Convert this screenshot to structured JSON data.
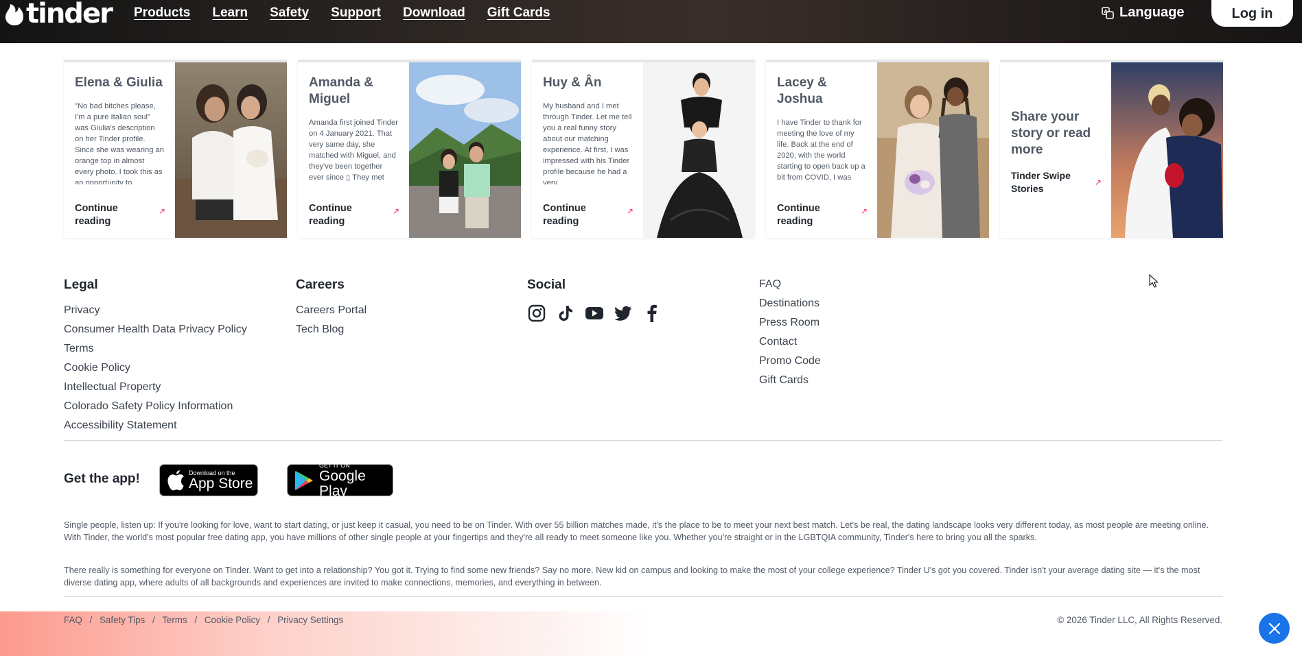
{
  "nav": {
    "logo_text": "tinder",
    "links": [
      "Products",
      "Learn",
      "Safety",
      "Support",
      "Download",
      "Gift Cards"
    ],
    "language_label": "Language",
    "login_label": "Log in"
  },
  "stories": [
    {
      "name": "Elena & Giulia",
      "blurb": "\"No bad bitches please, I'm a pure Italian soul\" was Giulia's description on her Tinder profile. Since she was wearing an orange top in almost every photo. I took this as an opportunity to...",
      "cta": "Continue reading"
    },
    {
      "name": "Amanda & Miguel",
      "blurb": "Amanda first joined Tinder on 4 January 2021. That very same day, she matched with Miguel, and they've been together ever since ▯ They met during",
      "cta": "Continue reading"
    },
    {
      "name": "Huy & Ân",
      "blurb": "My husband and I met through Tinder. Let me tell you a real funny story about our matching experience. At first, I was impressed with his Tinder profile because he had a very...",
      "cta": "Continue reading"
    },
    {
      "name": "Lacey & Joshua",
      "blurb": "I have Tinder to thank for meeting the love of my life. Back at the end of 2020, with the world starting to open back up a bit from COVID, I was swiping through Tinder",
      "cta": "Continue reading"
    }
  ],
  "share": {
    "title": "Share your story or read more",
    "link": "Tinder Swipe Stories"
  },
  "footer": {
    "legal": {
      "heading": "Legal",
      "links": [
        "Privacy",
        "Consumer Health Data Privacy Policy",
        "Terms",
        "Cookie Policy",
        "Intellectual Property",
        "Colorado Safety Policy Information",
        "Accessibility Statement"
      ]
    },
    "careers": {
      "heading": "Careers",
      "links": [
        "Careers Portal",
        "Tech Blog"
      ]
    },
    "social": {
      "heading": "Social",
      "icons": [
        "instagram-icon",
        "tiktok-icon",
        "youtube-icon",
        "twitter-icon",
        "facebook-icon"
      ]
    },
    "misc": {
      "links": [
        "FAQ",
        "Destinations",
        "Press Room",
        "Contact",
        "Promo Code",
        "Gift Cards"
      ]
    }
  },
  "get_app": {
    "label": "Get the app!",
    "appstore_small": "Download on the",
    "appstore_big": "App Store",
    "googleplay_small": "GET IT ON",
    "googleplay_big": "Google Play"
  },
  "paragraphs": [
    "Single people, listen up: If you're looking for love, want to start dating, or just keep it casual, you need to be on Tinder. With over 55 billion matches made, it's the place to be to meet your next best match. Let's be real, the dating landscape looks very different today, as most people are meeting online. With Tinder, the world's most popular free dating app, you have millions of other single people at your fingertips and they're all ready to meet someone like you. Whether you're straight or in the LGBTQIA community, Tinder's here to bring you all the sparks.",
    "There really is something for everyone on Tinder. Want to get into a relationship? You got it. Trying to find some new friends? Say no more. New kid on campus and looking to make the most of your college experience? Tinder U's got you covered. Tinder isn't your average dating site — it's the most diverse dating app, where adults of all backgrounds and experiences are invited to make connections, memories, and everything in between."
  ],
  "bottom": {
    "links": [
      "FAQ",
      "Safety Tips",
      "Terms",
      "Cookie Policy",
      "Privacy Settings"
    ],
    "separator": "/",
    "copyright": "© 2026 Tinder LLC, All Rights Reserved."
  },
  "colors": {
    "brand_pink": "#fd2e6a",
    "close_button": "#1a73e8"
  }
}
